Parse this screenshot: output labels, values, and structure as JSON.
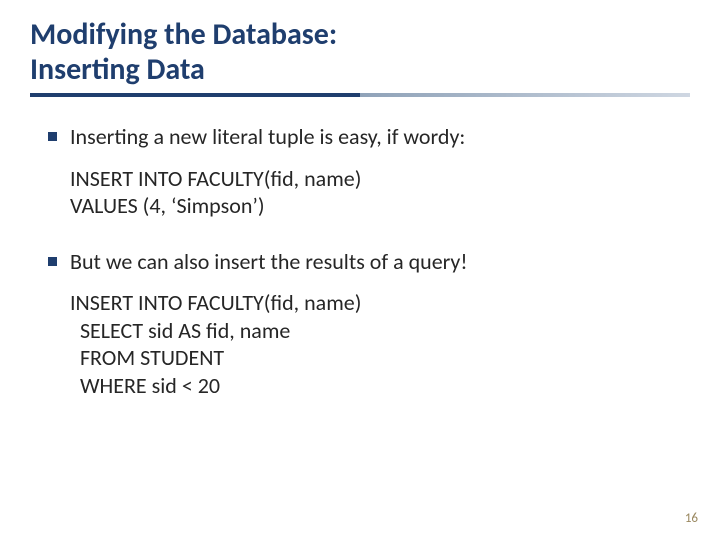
{
  "title": {
    "line1": "Modifying the Database:",
    "line2": "Inserting Data"
  },
  "bullets": {
    "b1": "Inserting a new literal tuple is easy, if wordy:",
    "code1": "INSERT INTO FACULTY(fid, name)\nVALUES (4, ‘Simpson’)",
    "b2": "But we can also insert the results of a query!",
    "code2": "INSERT INTO FACULTY(fid, name)\n  SELECT sid AS fid, name\n  FROM STUDENT\n  WHERE sid < 20"
  },
  "page": "16"
}
